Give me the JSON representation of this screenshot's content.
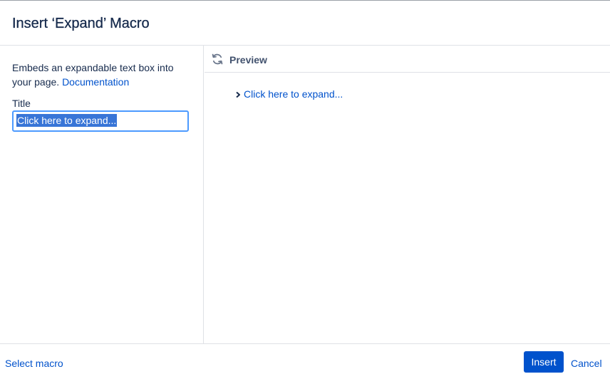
{
  "dialog": {
    "title": "Insert ‘Expand’ Macro"
  },
  "left_panel": {
    "description": "Embeds an expandable text box into your page.",
    "documentation_link": "Documentation",
    "title_label": "Title",
    "title_value": "Click here to expand..."
  },
  "preview": {
    "label": "Preview",
    "refresh_icon": "refresh-icon",
    "expand_text": "Click here to expand...",
    "chevron_icon": "chevron-right-icon"
  },
  "footer": {
    "select_macro": "Select macro",
    "insert_label": "Insert",
    "cancel_label": "Cancel"
  },
  "colors": {
    "primary": "#0052cc",
    "text": "#172b4d",
    "border": "#dfe1e6",
    "focus": "#4c9aff",
    "selection": "#3875d7"
  }
}
